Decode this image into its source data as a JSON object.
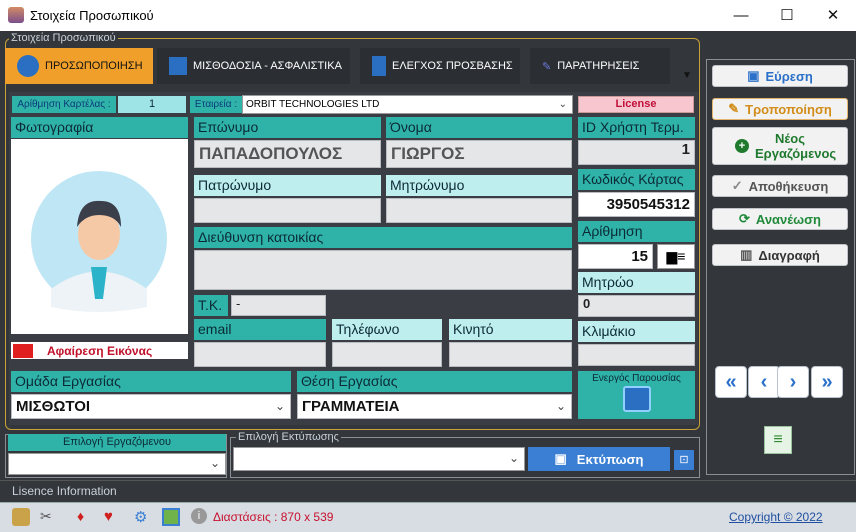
{
  "window": {
    "title": "Στοιχεία Προσωπικού",
    "minimize_glyph": "—",
    "maximize_glyph": "☐",
    "close_glyph": "✕"
  },
  "group_title": "Στοιχεία Προσωπικού",
  "tabs": [
    {
      "label": "ΠΡΟΣΩΠΟΠΟΙΗΣΗ",
      "icon": "people-icon"
    },
    {
      "label": "ΜΙΣΘΟΔΟΣΙΑ - ΑΣΦΑΛΙΣΤΙΚΑ",
      "icon": "chart-icon"
    },
    {
      "label": "ΕΛΕΓΧΟΣ ΠΡΟΣΒΑΣΗΣ",
      "icon": "building-icon"
    },
    {
      "label": "ΠΑΡΑΤΗΡΗΣΕΙΣ",
      "icon": "note-icon"
    }
  ],
  "form": {
    "card_no_label": "Αρίθμηση Καρτέλας :",
    "card_no_value": "1",
    "company_label": "Εταιρεία :",
    "company_value": "ORBIT TECHNOLOGIES LTD",
    "license_label": "License",
    "photo_label": "Φωτογραφία",
    "remove_image_label": "Αφαίρεση Εικόνας",
    "surname_label": "Επώνυμο",
    "surname_value": "ΠΑΠΑΔΟΠΟΥΛΟΣ",
    "name_label": "Όνομα",
    "name_value": "ΓΙΩΡΓΟΣ",
    "father_label": "Πατρώνυμο",
    "father_value": "",
    "mother_label": "Μητρώνυμο",
    "mother_value": "",
    "address_label": "Διεύθυνση κατοικίας",
    "address_value": "",
    "tk_label": "Τ.Κ.",
    "tk_value": "-",
    "email_label": "email",
    "email_value": "",
    "phone_label": "Τηλέφωνο",
    "phone_value": "",
    "mobile_label": "Κινητό",
    "mobile_value": "",
    "user_id_label": "ID Χρήστη Τερμ.",
    "user_id_value": "1",
    "card_code_label": "Κωδικός Κάρτας",
    "card_code_value": "3950545312",
    "numbering_label": "Αρίθμηση",
    "numbering_value": "15",
    "registry_label": "Μητρώο",
    "registry_value": "0",
    "scale_label": "Κλιμάκιο",
    "scale_value": "",
    "work_group_label": "Ομάδα Εργασίας",
    "work_group_value": "ΜΙΣΘΩΤΟΙ",
    "position_label": "Θέση Εργασίας",
    "position_value": "ΓΡΑΜΜΑΤΕΙΑ",
    "active_presence_label": "Ενεργός Παρουσίας"
  },
  "bottom": {
    "employee_select_label": "Επιλογή Εργαζόμενου",
    "employee_select_value": "",
    "print_select_label": "Επιλογή Εκτύπωσης",
    "print_select_value": "",
    "print_button": "Εκτύπωση"
  },
  "side_buttons": {
    "search": "Εύρεση",
    "edit": "Τροποποίηση",
    "new_employee": "Νέος Εργαζόμενος",
    "save": "Αποθήκευση",
    "refresh": "Ανανέωση",
    "delete": "Διαγραφή"
  },
  "nav": {
    "first": "«",
    "prev": "‹",
    "next": "›",
    "last": "»"
  },
  "licence_info": "Lisence Information",
  "status": {
    "dimensions": "Διαστάσεις : 870 x 539",
    "copyright": "Copyright ©  2022"
  },
  "colors": {
    "accent": "#f0a02a",
    "teal": "#2fb3a8",
    "license_bg": "#f7c6cf"
  }
}
